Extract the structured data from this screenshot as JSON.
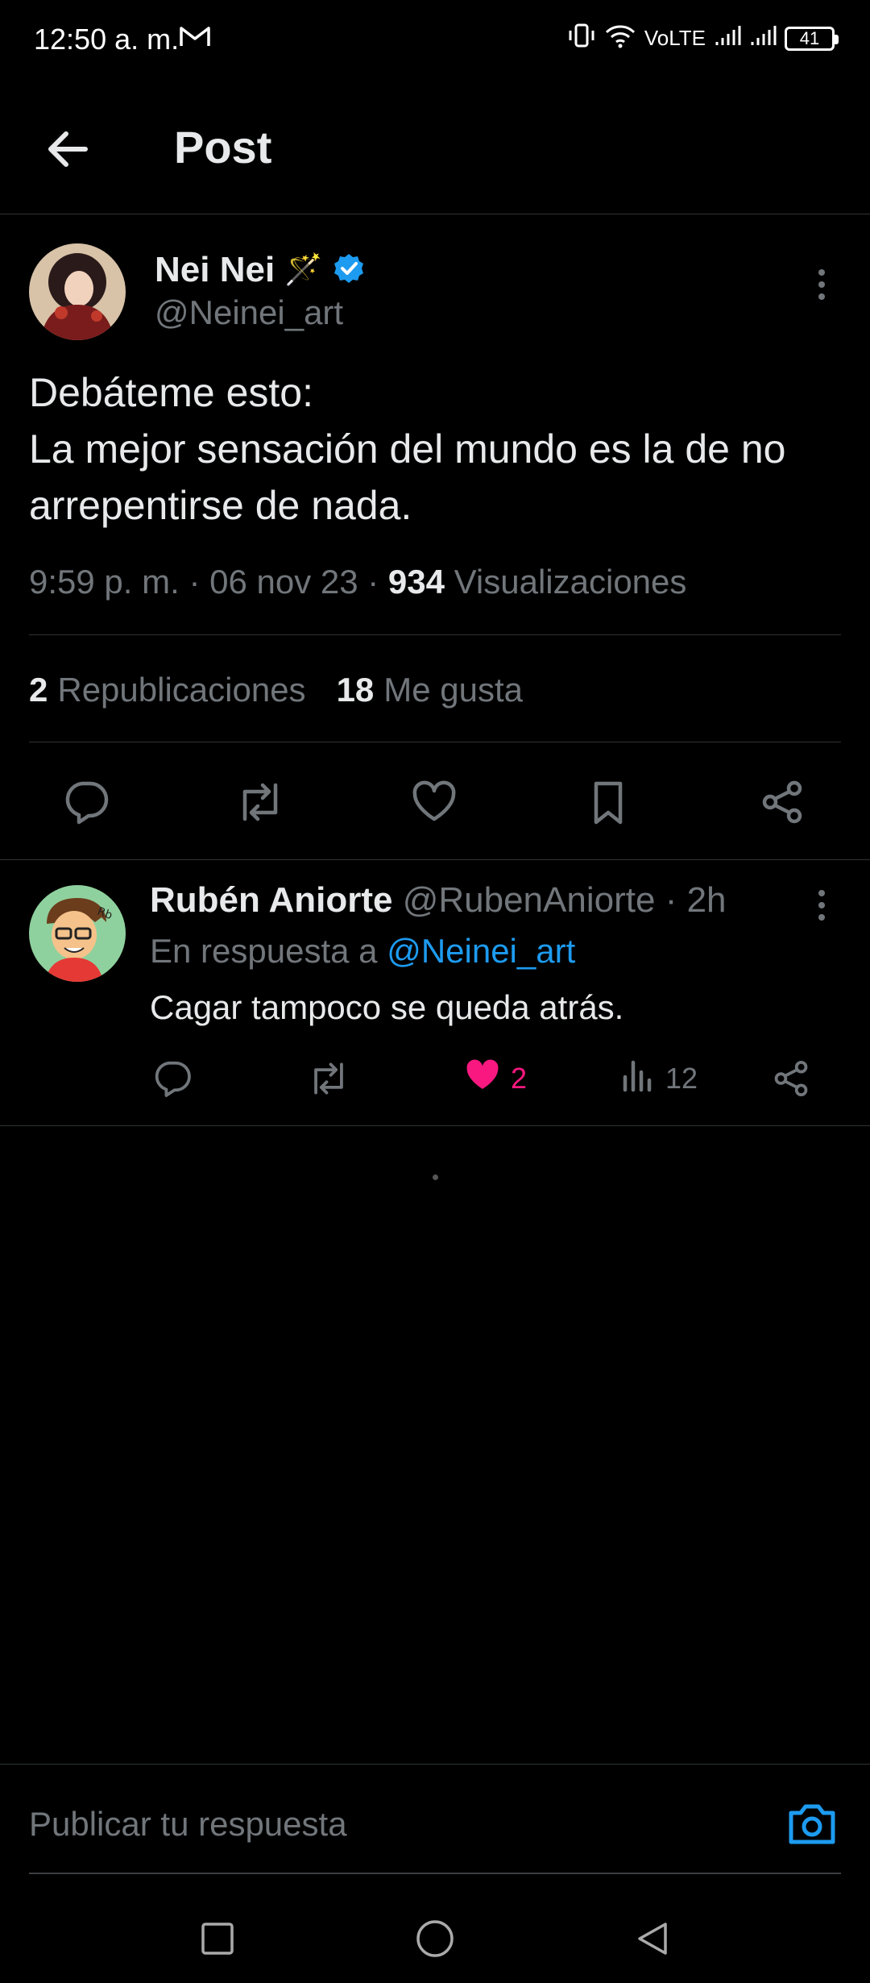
{
  "status_bar": {
    "time": "12:50 a. m.",
    "battery": "41",
    "network": "VoLTE"
  },
  "header": {
    "title": "Post"
  },
  "post": {
    "author_name": "Nei Nei",
    "author_emoji": "🪄",
    "handle": "@Neinei_art",
    "text": "Debáteme esto:\nLa mejor sensación del mundo es la de no arrepentirse de nada.",
    "time": "9:59 p. m.",
    "date": "06 nov 23",
    "views": "934",
    "views_label": "Visualizaciones",
    "reposts": "2",
    "reposts_label": "Republicaciones",
    "likes": "18",
    "likes_label": "Me gusta"
  },
  "reply": {
    "author_name": "Rubén Aniorte",
    "handle": "@RubenAniorte",
    "age": "2h",
    "reply_to_label": "En respuesta a",
    "reply_to_mention": "@Neinei_art",
    "text": "Cagar tampoco se queda atrás.",
    "likes": "2",
    "views": "12"
  },
  "compose": {
    "placeholder": "Publicar tu respuesta"
  },
  "colors": {
    "accent": "#1d9bf0",
    "like": "#f91880",
    "muted": "#71767b",
    "text": "#e7e9ea",
    "divider": "#2f3336"
  }
}
